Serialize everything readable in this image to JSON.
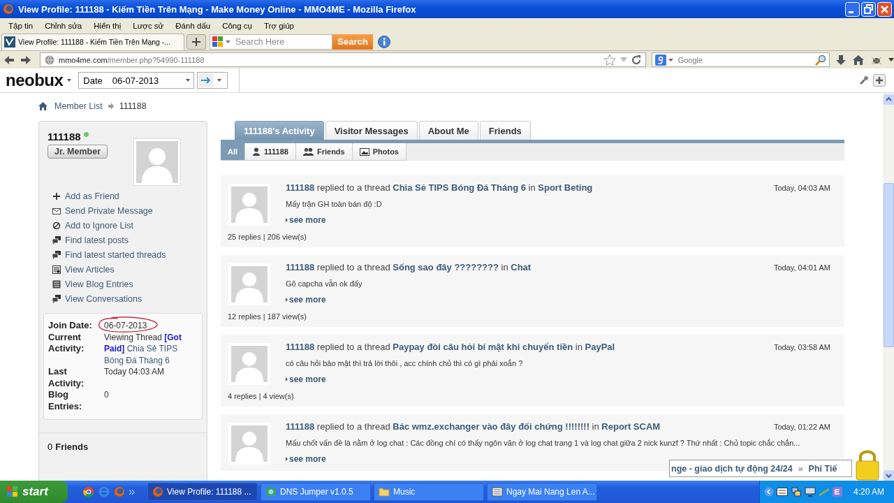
{
  "window": {
    "title": "View Profile: 111188 - Kiếm Tiền Trên Mạng - Make Money Online - MMO4ME - Mozilla Firefox"
  },
  "menu": [
    "Tập tin",
    "Chỉnh sửa",
    "Hiển thị",
    "Lược sử",
    "Đánh dấu",
    "Công cụ",
    "Trợ giúp"
  ],
  "browser_tabs": [
    {
      "label": "View Profile: 111188 - Kiếm Tiền Trên Mạng -...",
      "selected": true
    }
  ],
  "search_toolbar": {
    "placeholder": "Search Here",
    "button": "Search"
  },
  "navigation": {
    "url_host": "mmo4me.com",
    "url_path": "/member.php?54990-111188",
    "search_placeholder": "Google"
  },
  "neobux_toolbar": {
    "logo": "neobux",
    "date_label": "Date",
    "date_value": "06-07-2013"
  },
  "breadcrumb": [
    "Member List",
    "111188"
  ],
  "profile": {
    "username": "111188",
    "online": true,
    "rank": "Jr. Member",
    "actions": [
      {
        "label": "Add as Friend",
        "kind": "plus"
      },
      {
        "label": "Send Private Message",
        "kind": "mail"
      },
      {
        "label": "Add to Ignore List",
        "kind": "ignore"
      },
      {
        "label": "Find latest posts",
        "kind": "posts"
      },
      {
        "label": "Find latest started threads",
        "kind": "posts"
      },
      {
        "label": "View Articles",
        "kind": "articles"
      },
      {
        "label": "View Blog Entries",
        "kind": "blog"
      },
      {
        "label": "View Conversations",
        "kind": "posts"
      }
    ],
    "info": [
      {
        "kind": "circled",
        "label": "Join Date:",
        "value": "06-07-2013"
      },
      {
        "kind": "activity",
        "label": "Current Activity:",
        "value": "Viewing Thread",
        "tag": "[Got Paid]",
        "link": "Chia Sẻ TIPS Bóng Đá Tháng 6"
      },
      {
        "kind": "plain",
        "label": "Last Activity:",
        "value": "Today 04:03 AM"
      },
      {
        "kind": "plain",
        "label": "Blog Entries:",
        "value": "0"
      }
    ],
    "friends_count": "0",
    "friends_label": "Friends"
  },
  "profile_tabs": [
    {
      "label": "111188's Activity",
      "selected": true
    },
    {
      "label": "Visitor Messages",
      "selected": false
    },
    {
      "label": "About Me",
      "selected": false
    },
    {
      "label": "Friends",
      "selected": false
    }
  ],
  "filters": [
    {
      "label": "All",
      "kind": "none",
      "selected": true
    },
    {
      "label": "111188",
      "kind": "user",
      "selected": false
    },
    {
      "label": "Friends",
      "kind": "users",
      "selected": false
    },
    {
      "label": "Photos",
      "kind": "photo",
      "selected": false
    }
  ],
  "activities": [
    {
      "user": "111188",
      "action": "replied to a thread",
      "thread": "Chia Sẻ TIPS Bóng Đá Tháng 6",
      "in": "in",
      "forum": "Sport Beting",
      "time": "Today, 04:03 AM",
      "excerpt": "Mấy trận GH toàn bán độ :D",
      "see_more": "see more",
      "stats": "25 replies | 206 view(s)"
    },
    {
      "user": "111188",
      "action": "replied to a thread",
      "thread": "Sống sao đây ????????",
      "in": "in",
      "forum": "Chat",
      "time": "Today, 04:01 AM",
      "excerpt": "Gõ capcha vẫn ok đấy",
      "see_more": "see more",
      "stats": "12 replies | 187 view(s)"
    },
    {
      "user": "111188",
      "action": "replied to a thread",
      "thread": "Paypay đòi câu hỏi bí mật khi chuyển tiền",
      "in": "in",
      "forum": "PayPal",
      "time": "Today, 03:58 AM",
      "excerpt": "có câu hỏi bảo mật thì trả lời thôi , acc chính chủ thì có gì phải xoắn ?",
      "see_more": "see more",
      "stats": "4 replies | 4 view(s)"
    },
    {
      "user": "111188",
      "action": "replied to a thread",
      "thread": "Bác wmz.exchanger vào đây đối chứng !!!!!!!!",
      "in": "in",
      "forum": "Report SCAM",
      "time": "Today, 01:22 AM",
      "excerpt": "Mấu chốt vấn đề là nằm ở log chat : Các đồng chí có thấy ngôn văn ở log chat trang 1 và log chat giữa 2 nick kunzf ? Thứ nhất : Chủ topic chắc chắn...",
      "see_more": "see more"
    }
  ],
  "ticker": {
    "text": "nge - giao dịch tự động 24/24",
    "mark": "»",
    "next": "Phi Tiế"
  },
  "taskbar": {
    "start": "start",
    "tasks": [
      {
        "label": "View Profile: 111188 ...",
        "kind": "firefox",
        "selected": true
      },
      {
        "label": "DNS Jumper v1.0.5",
        "kind": "globe",
        "selected": false
      },
      {
        "label": "Music",
        "kind": "folder",
        "selected": false
      },
      {
        "label": "Ngay Mai Nang Len A...",
        "kind": "media",
        "selected": false
      }
    ],
    "clock": "4:20 AM"
  }
}
